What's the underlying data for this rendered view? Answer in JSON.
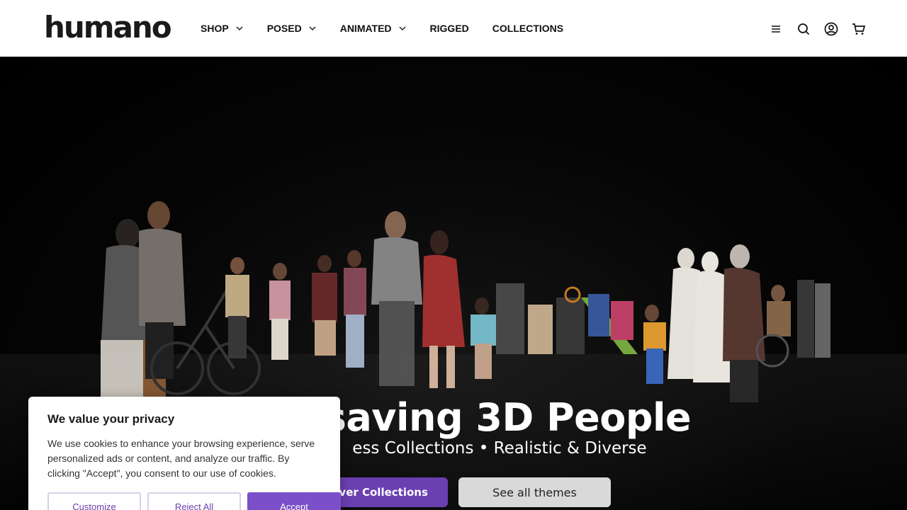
{
  "header": {
    "logo": "humano",
    "nav": [
      {
        "label": "SHOP",
        "has_dropdown": true
      },
      {
        "label": "POSED",
        "has_dropdown": true
      },
      {
        "label": "ANIMATED",
        "has_dropdown": true
      },
      {
        "label": "RIGGED",
        "has_dropdown": false
      },
      {
        "label": "COLLECTIONS",
        "has_dropdown": false
      }
    ],
    "icons": [
      "menu-icon",
      "search-icon",
      "account-icon",
      "cart-icon"
    ]
  },
  "hero": {
    "title": "-saving 3D People",
    "subtitle": "ess Collections • Realistic & Diverse",
    "primary_button": "over Collections",
    "secondary_button": "See all themes",
    "accent_color": "#6b3fb0"
  },
  "cookie": {
    "title": "We value your privacy",
    "text": "We use cookies to enhance your browsing experience, serve personalized ads or content, and analyze our traffic. By clicking \"Accept\", you consent to our use of cookies.",
    "customize": "Customize",
    "reject": "Reject All",
    "accept": "Accept"
  }
}
